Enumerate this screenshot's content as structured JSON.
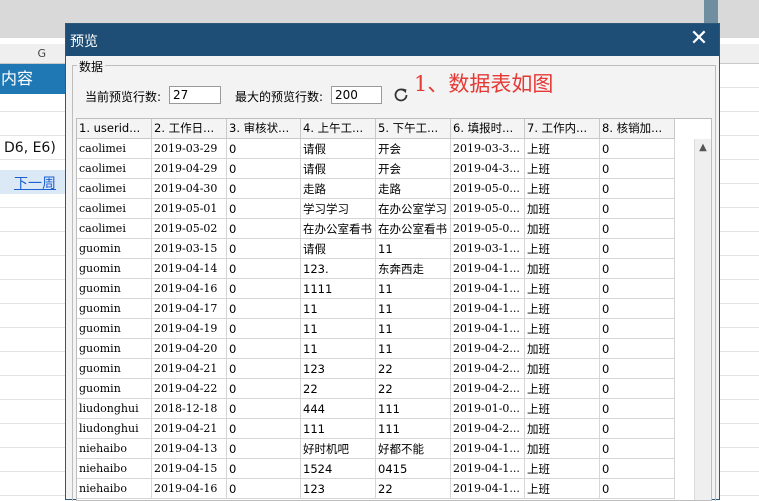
{
  "background": {
    "col_header": "G",
    "blue_cell_text": "内容",
    "formula_text": "D6, E6)",
    "link_text": "下一周"
  },
  "dialog": {
    "title": "预览",
    "close_glyph": "✕",
    "group_label": "数据",
    "current_rows_label": "当前预览行数:",
    "current_rows_value": "27",
    "max_rows_label": "最大的预览行数:",
    "max_rows_value": "200",
    "annotation": "1、数据表如图"
  },
  "grid": {
    "headers": [
      "1. userid...",
      "2. 工作日...",
      "3. 审核状...",
      "4. 上午工...",
      "5. 下午工...",
      "6. 填报时...",
      "7. 工作内...",
      "8. 核销加..."
    ],
    "rows": [
      [
        "caolimei",
        "2019-03-29",
        "0",
        "请假",
        "开会",
        "2019-03-3...",
        "上班",
        "0"
      ],
      [
        "caolimei",
        "2019-04-29",
        "0",
        "请假",
        "开会",
        "2019-04-3...",
        "上班",
        "0"
      ],
      [
        "caolimei",
        "2019-04-30",
        "0",
        "走路",
        "走路",
        "2019-05-0...",
        "上班",
        "0"
      ],
      [
        "caolimei",
        "2019-05-01",
        "0",
        "学习学习",
        "在办公室学习",
        "2019-05-0...",
        "加班",
        "0"
      ],
      [
        "caolimei",
        "2019-05-02",
        "0",
        "在办公室看书",
        "在办公室看书",
        "2019-05-0...",
        "加班",
        "0"
      ],
      [
        "guomin",
        "2019-03-15",
        "0",
        "请假",
        "11",
        "2019-03-1...",
        "上班",
        "0"
      ],
      [
        "guomin",
        "2019-04-14",
        "0",
        "123.",
        "东奔西走",
        "2019-04-1...",
        "加班",
        "0"
      ],
      [
        "guomin",
        "2019-04-16",
        "0",
        "1111",
        "11",
        "2019-04-1...",
        "上班",
        "0"
      ],
      [
        "guomin",
        "2019-04-17",
        "0",
        "11",
        "11",
        "2019-04-1...",
        "上班",
        "0"
      ],
      [
        "guomin",
        "2019-04-19",
        "0",
        "11",
        "11",
        "2019-04-1...",
        "上班",
        "0"
      ],
      [
        "guomin",
        "2019-04-20",
        "0",
        "11",
        "11",
        "2019-04-2...",
        "加班",
        "0"
      ],
      [
        "guomin",
        "2019-04-21",
        "0",
        "123",
        "22",
        "2019-04-2...",
        "加班",
        "0"
      ],
      [
        "guomin",
        "2019-04-22",
        "0",
        "22",
        "22",
        "2019-04-2...",
        "上班",
        "0"
      ],
      [
        "liudonghui",
        "2018-12-18",
        "0",
        "444",
        "111",
        "2019-01-0...",
        "上班",
        "0"
      ],
      [
        "liudonghui",
        "2019-04-21",
        "0",
        "111",
        "111",
        "2019-04-2...",
        "加班",
        "0"
      ],
      [
        "niehaibo",
        "2019-04-13",
        "0",
        "好时机吧",
        "好都不能",
        "2019-04-1...",
        "加班",
        "0"
      ],
      [
        "niehaibo",
        "2019-04-15",
        "0",
        "1524",
        "0415",
        "2019-04-1...",
        "上班",
        "0"
      ],
      [
        "niehaibo",
        "2019-04-16",
        "0",
        "123",
        "22",
        "2019-04-1...",
        "上班",
        "0"
      ]
    ]
  },
  "icons": {
    "refresh": "refresh-icon",
    "scroll_up": "▲"
  },
  "colors": {
    "titlebar": "#1e4e76",
    "annotation": "#e53935",
    "cell_blue": "#1f78b4"
  }
}
